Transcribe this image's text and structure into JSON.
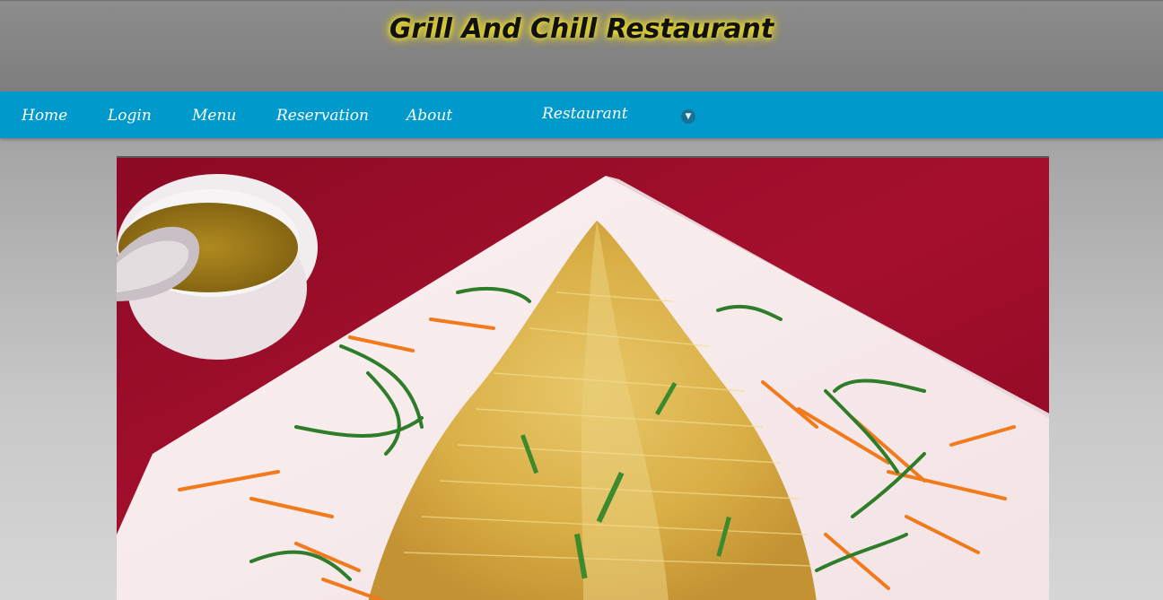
{
  "header": {
    "title": "Grill And Chill Restaurant"
  },
  "nav": {
    "items": [
      {
        "label": "Home"
      },
      {
        "label": "Login"
      },
      {
        "label": "Menu"
      },
      {
        "label": "Reservation"
      },
      {
        "label": "About"
      }
    ],
    "dropdown": {
      "label": "Restaurant",
      "icon": "chevron-down-icon"
    }
  },
  "colors": {
    "nav_background": "#0099cc",
    "header_background": "#848484",
    "title_glow": "#e8d420",
    "nav_text": "#ffffff"
  },
  "hero": {
    "icon": "food-photo"
  }
}
